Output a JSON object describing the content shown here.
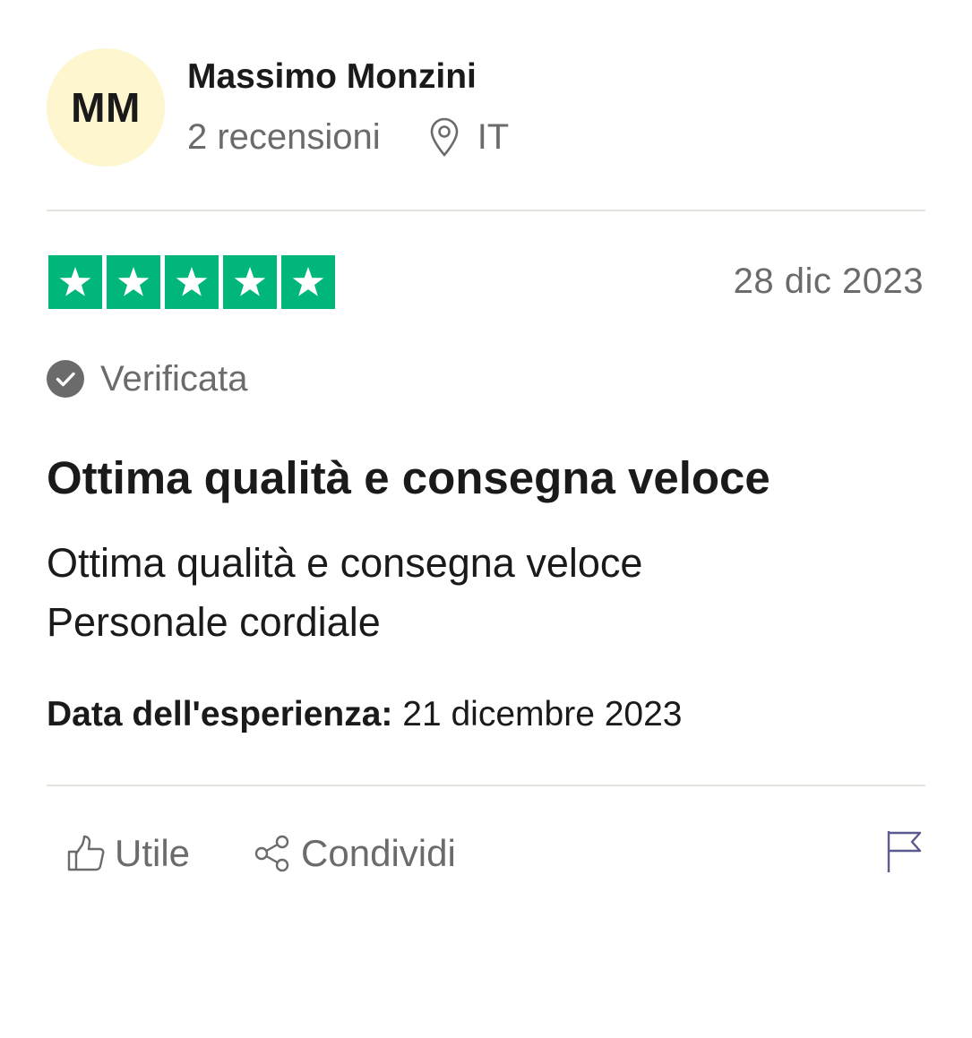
{
  "reviewer": {
    "initials": "MM",
    "name": "Massimo Monzini",
    "reviews_count": "2 recensioni",
    "country": "IT"
  },
  "review": {
    "rating": 5,
    "rating_max": 5,
    "date": "28 dic 2023",
    "verified_label": "Verificata",
    "title": "Ottima qualità e consegna veloce",
    "body_lines": [
      "Ottima qualità e consegna veloce",
      "Personale cordiale"
    ],
    "experience_label": "Data dell'esperienza:",
    "experience_date": "21 dicembre 2023"
  },
  "actions": {
    "helpful_label": "Utile",
    "share_label": "Condividi"
  },
  "colors": {
    "star_green": "#00b67a",
    "avatar_bg": "#fdf6cf",
    "muted_text": "#6b6b6b",
    "divider": "#e6e4dd",
    "flag": "#5a5a8c"
  },
  "icons": [
    "location-pin-icon",
    "star-icon",
    "verified-check-icon",
    "thumbs-up-icon",
    "share-icon",
    "flag-icon"
  ]
}
